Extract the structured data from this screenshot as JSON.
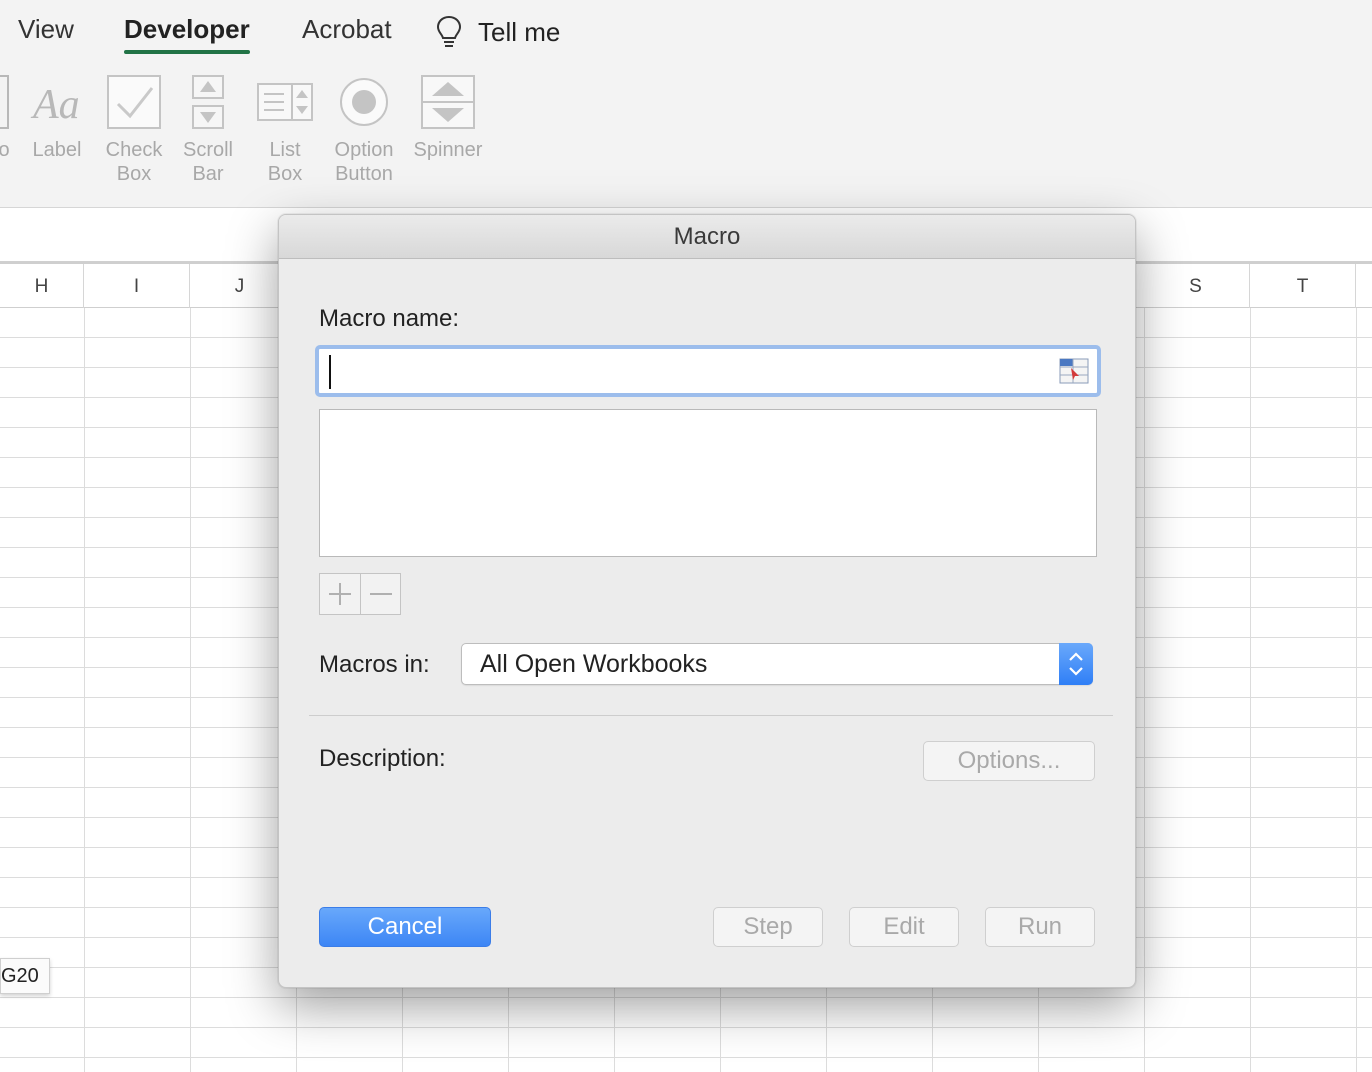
{
  "ribbon": {
    "tabs": [
      {
        "label": "View"
      },
      {
        "label": "Developer"
      },
      {
        "label": "Acrobat"
      }
    ],
    "tell_me": "Tell me",
    "controls": [
      {
        "label": "o"
      },
      {
        "label": "Label"
      },
      {
        "label": "Check\nBox"
      },
      {
        "label": "Scroll\nBar"
      },
      {
        "label": "List\nBox"
      },
      {
        "label": "Option\nButton"
      },
      {
        "label": "Spinner"
      }
    ]
  },
  "sheet": {
    "columns": [
      "H",
      "I",
      "J",
      "S",
      "T"
    ],
    "cell_tip": "G20"
  },
  "dialog": {
    "title": "Macro",
    "macro_name_label": "Macro name:",
    "macro_name_value": "",
    "macros_in_label": "Macros in:",
    "macros_in_value": "All Open Workbooks",
    "description_label": "Description:",
    "buttons": {
      "options": "Options...",
      "cancel": "Cancel",
      "step": "Step",
      "edit": "Edit",
      "run": "Run"
    }
  },
  "colors": {
    "developer_tab_underline": "#217346",
    "focus_ring": "#9cbdec",
    "primary_button": "#3d86f5"
  }
}
